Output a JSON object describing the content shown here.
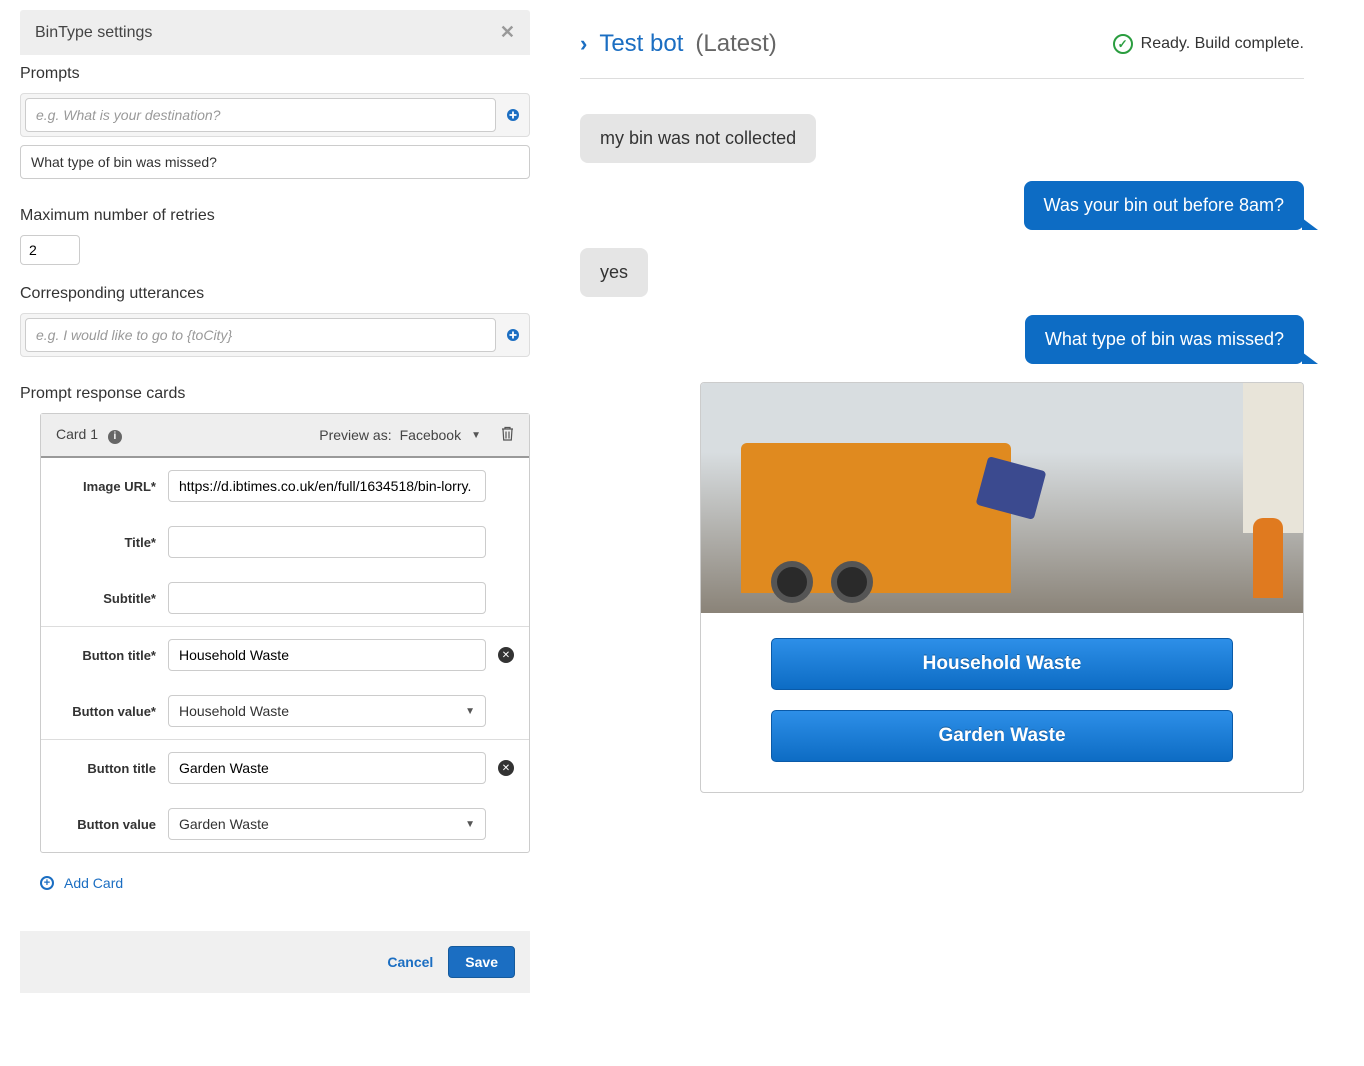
{
  "settings": {
    "title": "BinType settings",
    "prompts": {
      "label": "Prompts",
      "placeholder": "e.g. What is your destination?",
      "items": [
        "What type of bin was missed?"
      ]
    },
    "retries": {
      "label": "Maximum number of retries",
      "value": "2"
    },
    "utterances": {
      "label": "Corresponding utterances",
      "placeholder": "e.g. I would like to go to {toCity}"
    },
    "response_cards": {
      "label": "Prompt response cards",
      "card_title": "Card 1",
      "preview_label": "Preview as:",
      "preview_value": "Facebook",
      "fields": {
        "image_url_label": "Image URL*",
        "image_url_value": "https://d.ibtimes.co.uk/en/full/1634518/bin-lorry.",
        "title_label": "Title*",
        "title_value": "",
        "subtitle_label": "Subtitle*",
        "subtitle_value": ""
      },
      "buttons": [
        {
          "title_label": "Button title*",
          "title_value": "Household Waste",
          "value_label": "Button value*",
          "value_value": "Household Waste"
        },
        {
          "title_label": "Button title",
          "title_value": "Garden Waste",
          "value_label": "Button value",
          "value_value": "Garden Waste"
        }
      ],
      "add_card_label": "Add Card"
    },
    "actions": {
      "cancel": "Cancel",
      "save": "Save"
    }
  },
  "test": {
    "title": "Test bot",
    "suffix": "(Latest)",
    "status": "Ready. Build complete.",
    "messages": [
      {
        "role": "user",
        "text": "my bin was not collected"
      },
      {
        "role": "bot",
        "text": "Was your bin out before 8am?"
      },
      {
        "role": "user",
        "text": "yes"
      },
      {
        "role": "bot",
        "text": "What type of bin was missed?"
      }
    ],
    "card_buttons": [
      "Household Waste",
      "Garden Waste"
    ]
  }
}
